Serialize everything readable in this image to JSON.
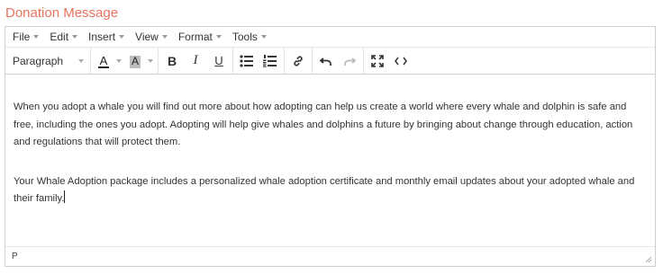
{
  "field": {
    "label": "Donation Message"
  },
  "menubar": {
    "items": [
      {
        "label": "File"
      },
      {
        "label": "Edit"
      },
      {
        "label": "Insert"
      },
      {
        "label": "View"
      },
      {
        "label": "Format"
      },
      {
        "label": "Tools"
      }
    ]
  },
  "toolbar": {
    "block_format": "Paragraph",
    "text_color_letter": "A",
    "highlight_letter": "A",
    "bold_glyph": "B",
    "italic_glyph": "I",
    "underline_glyph": "U",
    "icons": [
      "text-color-icon",
      "highlight-icon",
      "bold-icon",
      "italic-icon",
      "underline-icon",
      "bullet-list-icon",
      "numbered-list-icon",
      "link-icon",
      "undo-icon",
      "redo-icon",
      "fullscreen-icon",
      "source-code-icon"
    ],
    "colors": {
      "text_color_bar": "#222222",
      "highlight_bg": "#bdbdbd",
      "disabled": "#bbbbbb"
    }
  },
  "content": {
    "paragraphs": [
      "When you adopt a whale you will find out more about how adopting can help us create a world where every whale and dolphin is safe and free, including the ones you adopt. Adopting will help give whales and dolphins a future by bringing about change through education, action and regulations that will protect them.",
      "Your Whale Adoption package includes a personalized whale adoption certificate and monthly email updates about your adopted whale and their family."
    ]
  },
  "statusbar": {
    "path": "P"
  },
  "colors": {
    "label": "#e8735f",
    "border": "#cfcfcf"
  }
}
